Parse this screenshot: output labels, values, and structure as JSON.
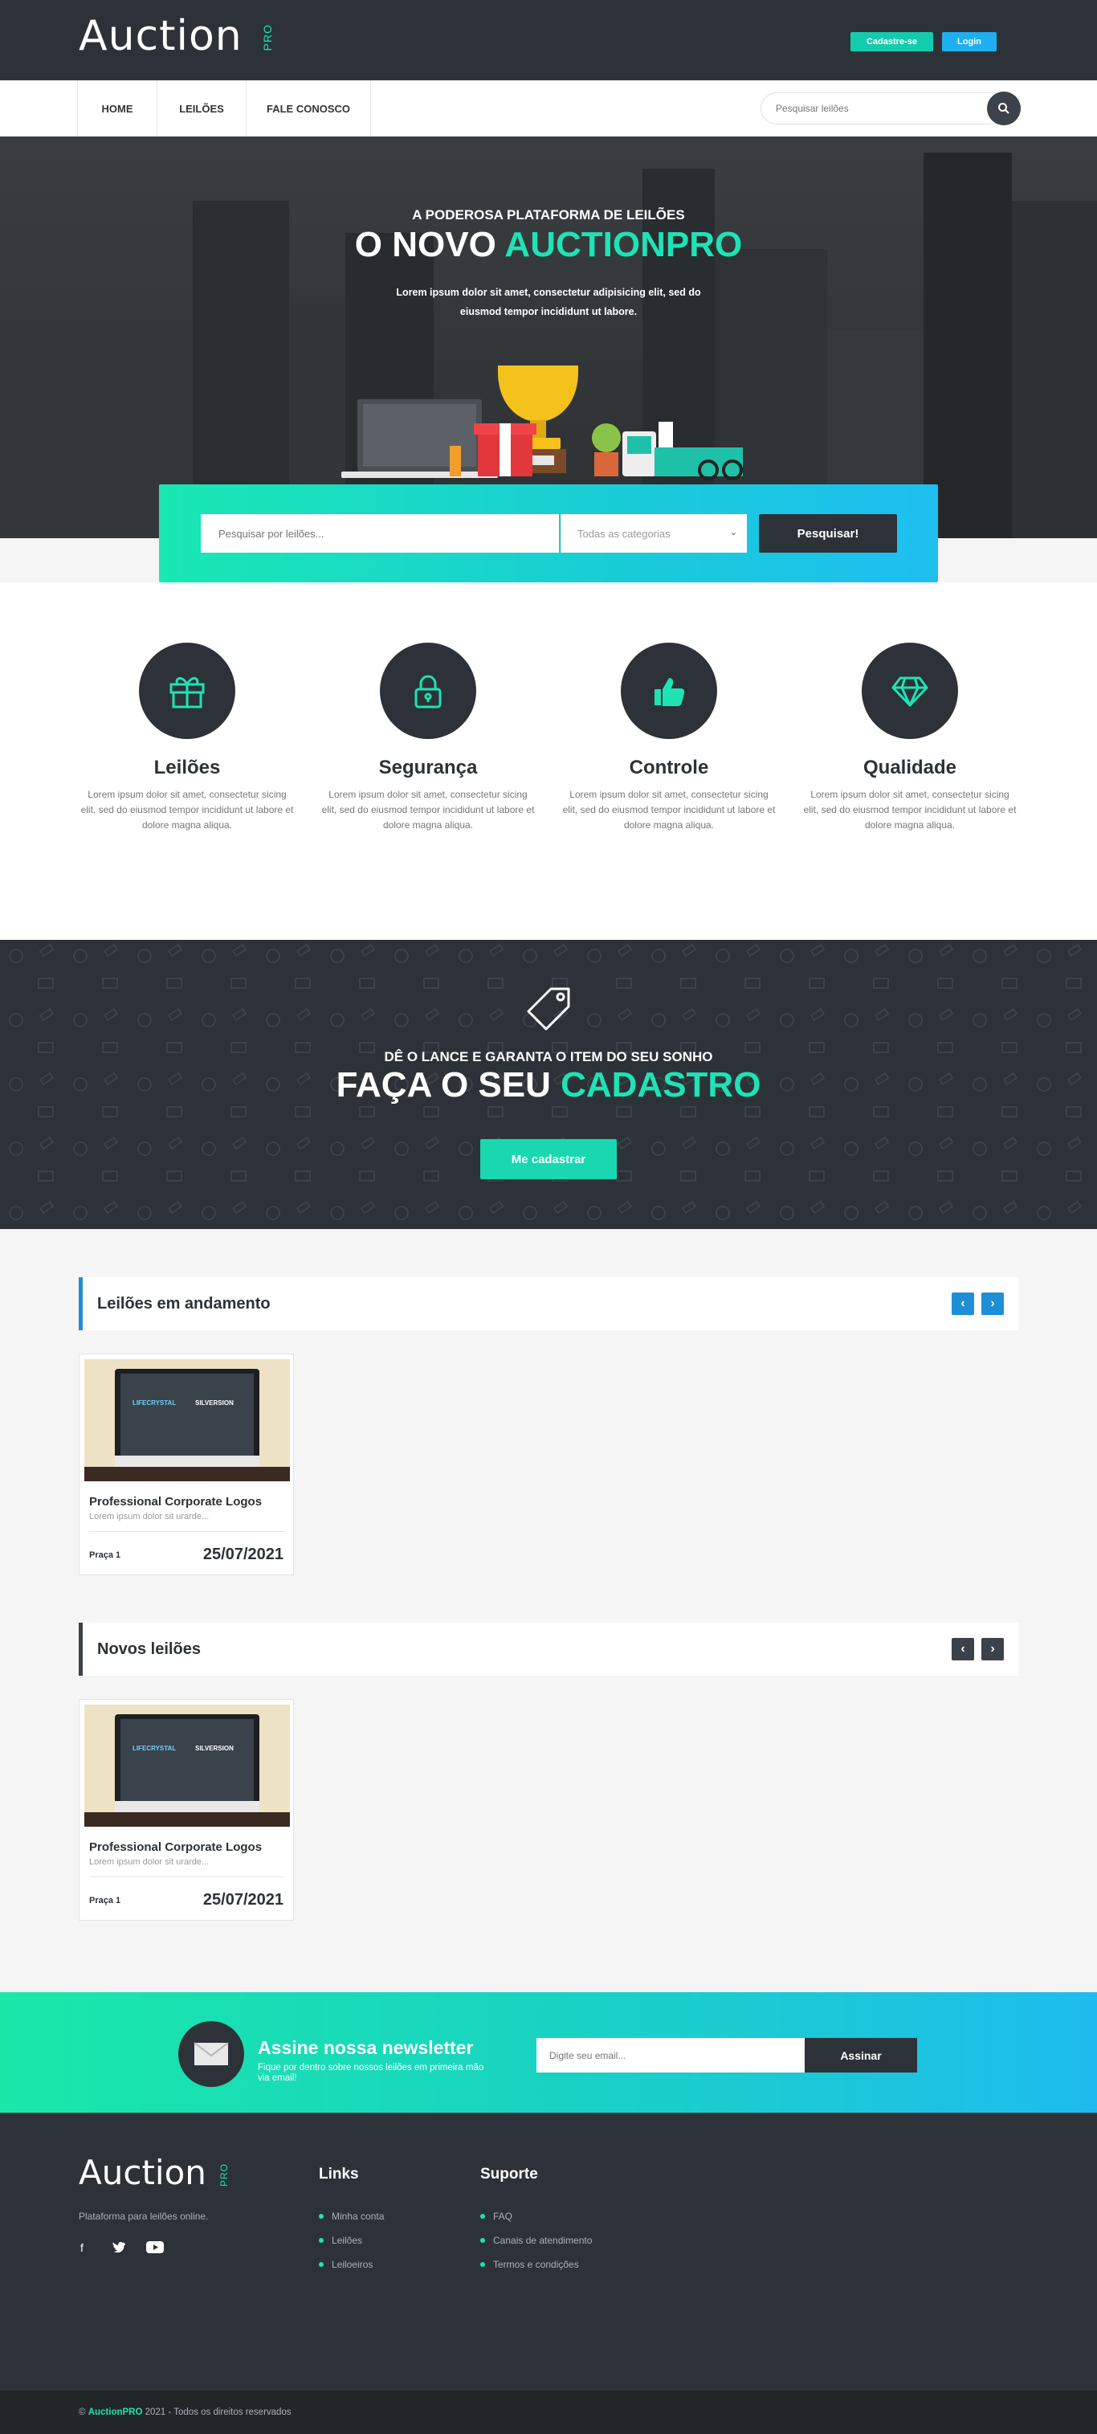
{
  "header": {
    "logo": "Auction",
    "logo_sup": "PRO",
    "register_label": "Cadastre-se",
    "login_label": "Login"
  },
  "nav": {
    "items": [
      "HOME",
      "LEILÕES",
      "FALE CONOSCO"
    ],
    "search_placeholder": "Pesquisar leilões"
  },
  "hero": {
    "subtitle": "A PODEROSA PLATAFORMA DE LEILÕES",
    "title_prefix": "O NOVO ",
    "title_accent": "AUCTIONPRO",
    "description": "Lorem ipsum dolor sit amet, consectetur adipisicing elit, sed do eiusmod tempor incididunt ut labore."
  },
  "search": {
    "placeholder": "Pesquisar por leilões...",
    "category": "Todas as categorias",
    "button": "Pesquisar!"
  },
  "features": [
    {
      "title": "Leilões",
      "icon": "gift-icon",
      "desc": "Lorem ipsum dolor sit amet, consectetur sicing elit, sed do eiusmod tempor incididunt ut labore et dolore magna aliqua."
    },
    {
      "title": "Segurança",
      "icon": "lock-icon",
      "desc": "Lorem ipsum dolor sit amet, consectetur sicing elit, sed do eiusmod tempor incididunt ut labore et dolore magna aliqua."
    },
    {
      "title": "Controle",
      "icon": "thumbs-up-icon",
      "desc": "Lorem ipsum dolor sit amet, consectetur sicing elit, sed do eiusmod tempor incididunt ut labore et dolore magna aliqua."
    },
    {
      "title": "Qualidade",
      "icon": "diamond-icon",
      "desc": "Lorem ipsum dolor sit amet, consectetur sicing elit, sed do eiusmod tempor incididunt ut labore et dolore magna aliqua."
    }
  ],
  "cta": {
    "subtitle": "DÊ O LANCE E GARANTA O ITEM DO SEU SONHO",
    "title_prefix": "FAÇA O SEU ",
    "title_accent": "CADASTRO",
    "button": "Me cadastrar"
  },
  "sections": [
    {
      "title": "Leilões em andamento",
      "card": {
        "title": "Professional Corporate Logos",
        "desc": "Lorem ipsum dolor sit urarde...",
        "praca": "Praça 1",
        "date": "25/07/2021",
        "logo_left": "LIFECRYSTAL",
        "logo_right": "SILVERSION"
      }
    },
    {
      "title": "Novos leilões",
      "card": {
        "title": "Professional Corporate Logos",
        "desc": "Lorem ipsum dolor sit urarde...",
        "praca": "Praça 1",
        "date": "25/07/2021",
        "logo_left": "LIFECRYSTAL",
        "logo_right": "SILVERSION"
      }
    }
  ],
  "newsletter": {
    "title": "Assine nossa newsletter",
    "desc": "Fique por dentro sobre nossos leilões em primeira mão via email!",
    "placeholder": "Digite seu email...",
    "button": "Assinar"
  },
  "footer": {
    "logo": "Auction",
    "logo_sup": "PRO",
    "tagline": "Plataforma para leilões online.",
    "links_title": "Links",
    "links": [
      "Minha conta",
      "Leilões",
      "Leiloeiros"
    ],
    "support_title": "Suporte",
    "support": [
      "FAQ",
      "Canais de atendimento",
      "Termos e condições"
    ],
    "copy_prefix": "©",
    "copy_brand": "AuctionPRO",
    "copy_suffix": "2021 - Todos os direitos reservados"
  },
  "colors": {
    "accent": "#1ee3b4",
    "dark": "#2c3238",
    "blue": "#1e8ed6"
  }
}
